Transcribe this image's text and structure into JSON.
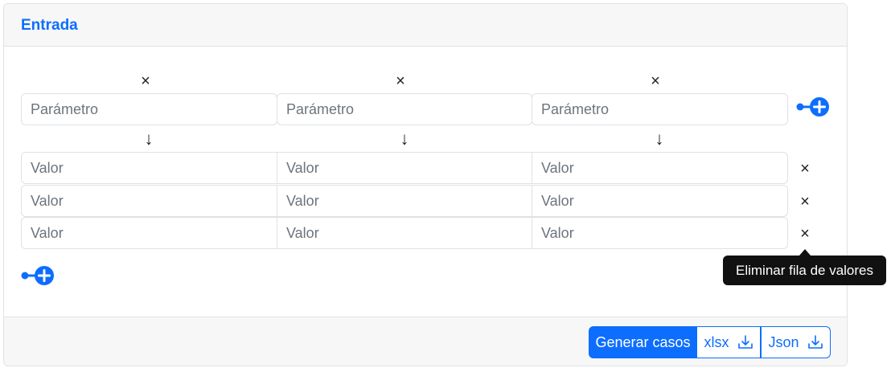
{
  "card": {
    "title": "Entrada"
  },
  "remove_column_symbol": "×",
  "remove_row_symbol": "×",
  "arrow_symbol": "↓",
  "params": [
    {
      "placeholder": "Parámetro",
      "value": ""
    },
    {
      "placeholder": "Parámetro",
      "value": ""
    },
    {
      "placeholder": "Parámetro",
      "value": ""
    }
  ],
  "rows": [
    [
      {
        "placeholder": "Valor",
        "value": ""
      },
      {
        "placeholder": "Valor",
        "value": ""
      },
      {
        "placeholder": "Valor",
        "value": ""
      }
    ],
    [
      {
        "placeholder": "Valor",
        "value": ""
      },
      {
        "placeholder": "Valor",
        "value": ""
      },
      {
        "placeholder": "Valor",
        "value": ""
      }
    ],
    [
      {
        "placeholder": "Valor",
        "value": ""
      },
      {
        "placeholder": "Valor",
        "value": ""
      },
      {
        "placeholder": "Valor",
        "value": ""
      }
    ]
  ],
  "tooltip": {
    "text": "Eliminar fila de valores"
  },
  "footer": {
    "generate_label": "Generar casos",
    "xlsx_label": "xlsx",
    "json_label": "Json",
    "download_icon": "download-icon"
  },
  "colors": {
    "accent": "#0d6efd",
    "tooltip_bg": "#111111"
  }
}
